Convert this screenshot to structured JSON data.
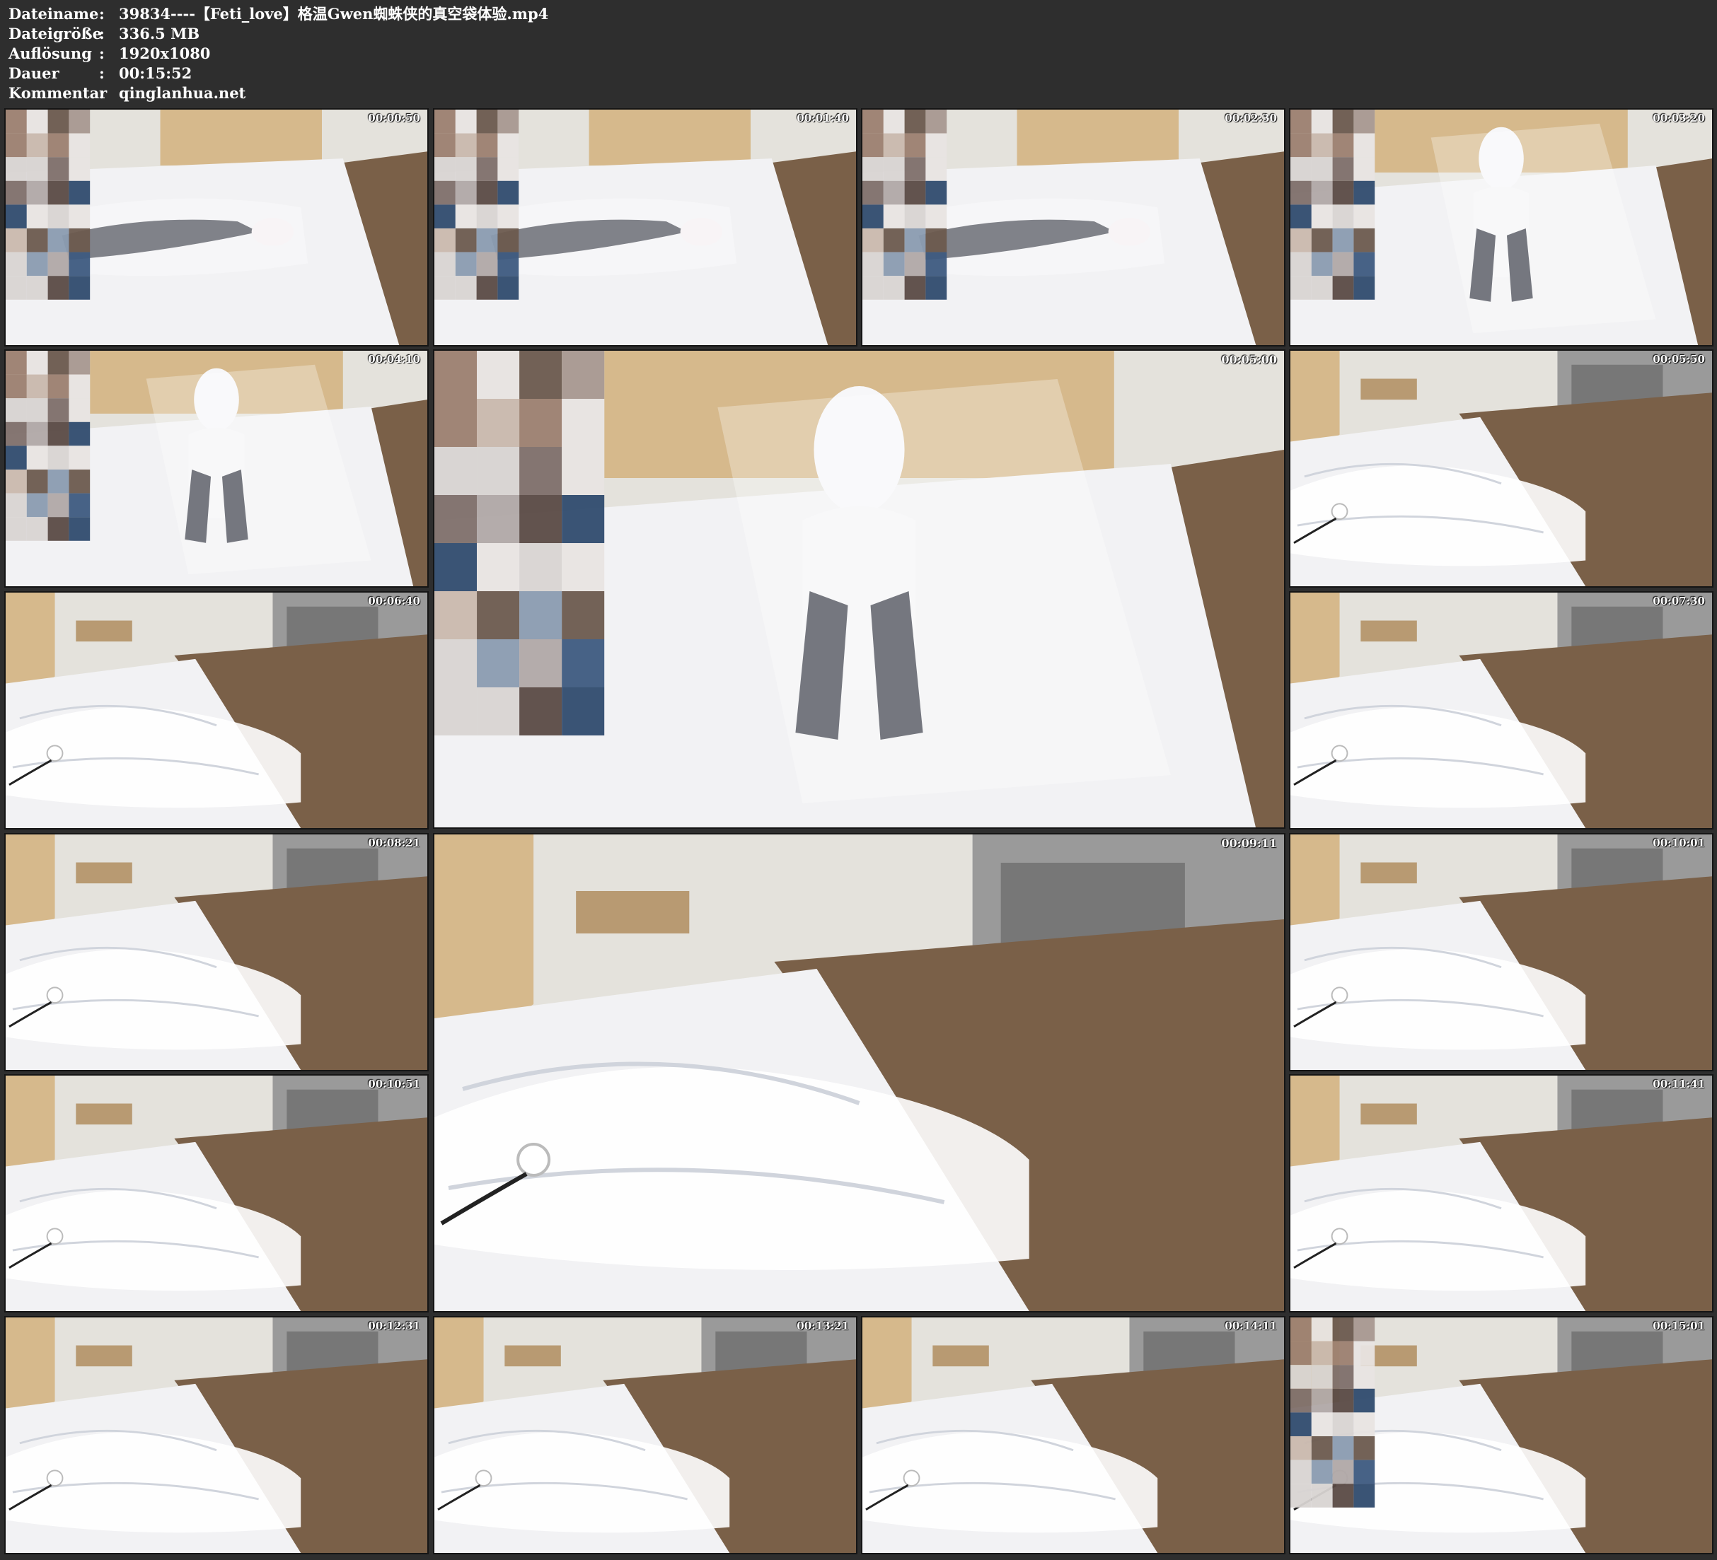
{
  "info": [
    {
      "key": "Dateiname",
      "value": "39834----【Feti_love】格温Gwen蜘蛛侠的真空袋体验.mp4"
    },
    {
      "key": "Dateigröße",
      "value": "336.5 MB"
    },
    {
      "key": "Auflösung",
      "value": "1920x1080"
    },
    {
      "key": "Dauer",
      "value": "00:15:52"
    },
    {
      "key": "Kommentar",
      "value": "qinglanhua.net"
    }
  ],
  "separator": ":",
  "frames": [
    {
      "ts": "00:00:50",
      "scene": "figure-lying",
      "mosaic": true
    },
    {
      "ts": "00:01:40",
      "scene": "figure-lying",
      "mosaic": true
    },
    {
      "ts": "00:02:30",
      "scene": "figure-lying",
      "mosaic": true
    },
    {
      "ts": "00:03:20",
      "scene": "figure-sitting",
      "mosaic": true
    },
    {
      "ts": "00:04:10",
      "scene": "figure-sitting",
      "mosaic": true
    },
    {
      "ts": "00:05:00",
      "scene": "figure-sitting",
      "mosaic": true
    },
    {
      "ts": "00:05:50",
      "scene": "bed-vacuum",
      "mosaic": false
    },
    {
      "ts": "00:06:40",
      "scene": "bed-vacuum",
      "mosaic": false
    },
    {
      "ts": "00:07:30",
      "scene": "bed-vacuum",
      "mosaic": false
    },
    {
      "ts": "00:08:21",
      "scene": "bed-vacuum",
      "mosaic": false
    },
    {
      "ts": "00:09:11",
      "scene": "bed-vacuum",
      "mosaic": false
    },
    {
      "ts": "00:10:01",
      "scene": "bed-vacuum",
      "mosaic": false
    },
    {
      "ts": "00:10:51",
      "scene": "bed-vacuum",
      "mosaic": false
    },
    {
      "ts": "00:11:41",
      "scene": "bed-vacuum",
      "mosaic": false
    },
    {
      "ts": "00:12:31",
      "scene": "bed-vacuum",
      "mosaic": false
    },
    {
      "ts": "00:13:21",
      "scene": "bed-vacuum",
      "mosaic": false
    },
    {
      "ts": "00:14:11",
      "scene": "bed-vacuum",
      "mosaic": false
    },
    {
      "ts": "00:15:01",
      "scene": "bed-vacuum",
      "mosaic": true
    }
  ],
  "colors": {
    "background": "#2e2e2e",
    "text": "#ffffff",
    "sheet": "#f2f2f4",
    "floor": "#7a6048",
    "wall": "#e4e2dc",
    "headboard": "#d6b98c"
  }
}
